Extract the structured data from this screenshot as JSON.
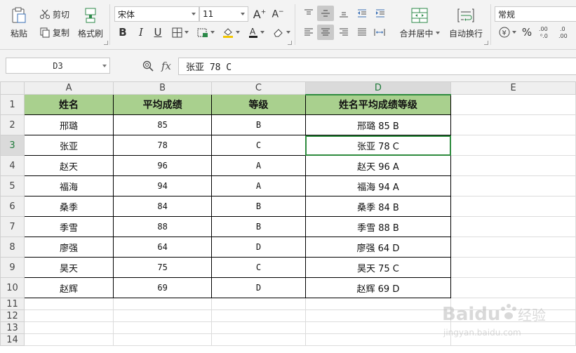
{
  "ribbon": {
    "paste": "粘贴",
    "cut": "剪切",
    "copy": "复制",
    "format_painter": "格式刷",
    "font_name": "宋体",
    "font_size": "11",
    "merge_center": "合并居中",
    "wrap_text": "自动换行",
    "number_format": "常规",
    "percent": "%"
  },
  "formula_bar": {
    "cell_ref": "D3",
    "fx_label": "fx",
    "content": "张亚 78 C"
  },
  "sheet": {
    "columns": [
      "A",
      "B",
      "C",
      "D",
      "E"
    ],
    "rows": [
      "1",
      "2",
      "3",
      "4",
      "5",
      "6",
      "7",
      "8",
      "9",
      "10",
      "11",
      "12",
      "13",
      "14"
    ],
    "headers": [
      "姓名",
      "平均成绩",
      "等级",
      "姓名平均成绩等级"
    ],
    "data": [
      [
        "邢璐",
        "85",
        "B",
        "邢璐 85 B"
      ],
      [
        "张亚",
        "78",
        "C",
        "张亚 78 C"
      ],
      [
        "赵天",
        "96",
        "A",
        "赵天 96 A"
      ],
      [
        "福海",
        "94",
        "A",
        "福海 94 A"
      ],
      [
        "桑季",
        "84",
        "B",
        "桑季 84 B"
      ],
      [
        "季雪",
        "88",
        "B",
        "季雪 88 B"
      ],
      [
        "廖强",
        "64",
        "D",
        "廖强 64 D"
      ],
      [
        "昊天",
        "75",
        "C",
        "昊天 75 C"
      ],
      [
        "赵辉",
        "69",
        "D",
        "赵辉 69 D"
      ]
    ],
    "selected_cell": "D3",
    "header_fill": "#a9d08e",
    "selection_color": "#2e8b3e"
  },
  "watermark": {
    "brand": "Baidu",
    "cn": "经验",
    "url": "jingyan.baidu.com"
  }
}
